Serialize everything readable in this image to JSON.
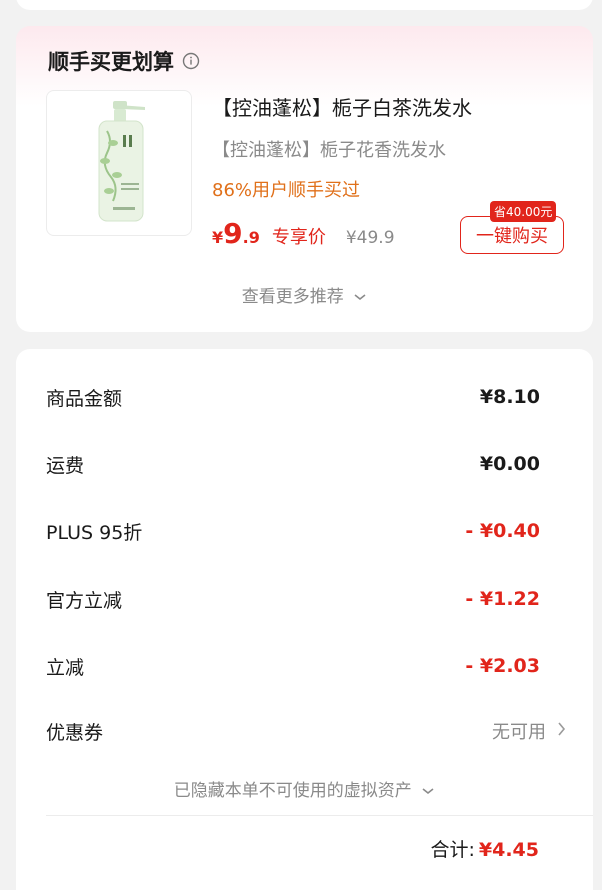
{
  "recommend": {
    "title": "顺手买更划算",
    "product_name": "【控油蓬松】栀子白茶洗发水",
    "product_subtitle": "【控油蓬松】栀子花香洗发水",
    "tag": "86%用户顺手买过",
    "price_symbol": "¥",
    "price_integer": "9",
    "price_decimal": ".9",
    "price_label": "专享价",
    "original_price": "¥49.9",
    "save_badge": "省40.00元",
    "buy_button": "一键购买",
    "more_label": "查看更多推荐"
  },
  "summary": {
    "rows": [
      {
        "label": "商品金额",
        "value": "¥8.10"
      },
      {
        "label": "运费",
        "value": "¥0.00"
      },
      {
        "label": "PLUS 95折",
        "value": "- ¥0.40"
      },
      {
        "label": "官方立减",
        "value": "- ¥1.22"
      },
      {
        "label": "立减",
        "value": "- ¥2.03"
      }
    ],
    "coupon_label": "优惠券",
    "coupon_value": "无可用",
    "hidden_assets": "已隐藏本单不可使用的虚拟资产",
    "total_label": "合计:",
    "total_value": "¥4.45"
  },
  "colors": {
    "accent": "#e1251b",
    "tag_orange": "#e0701a",
    "muted": "#8a8a8a"
  },
  "icons": [
    "info-icon",
    "chevron-down-icon",
    "chevron-right-icon"
  ]
}
